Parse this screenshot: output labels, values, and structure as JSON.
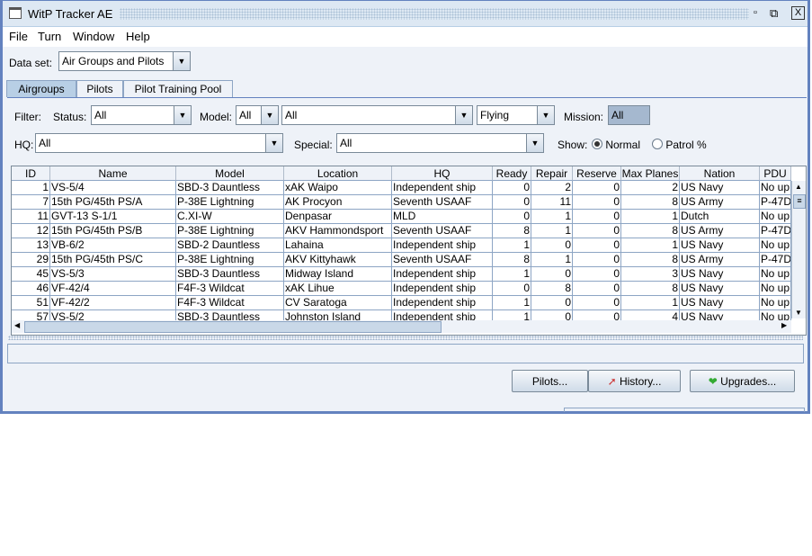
{
  "window": {
    "title": "WitP Tracker AE"
  },
  "menu": [
    "File",
    "Turn",
    "Window",
    "Help"
  ],
  "dataset": {
    "label": "Data set:",
    "value": "Air Groups and Pilots"
  },
  "tabs": [
    {
      "label": "Airgroups",
      "selected": true
    },
    {
      "label": "Pilots"
    },
    {
      "label": "Pilot Training Pool"
    }
  ],
  "filters": {
    "filter_label": "Filter:",
    "status_label": "Status:",
    "status": "All",
    "model_label": "Model:",
    "model_type": "All",
    "model": "All",
    "flying": "Flying",
    "mission_label": "Mission:",
    "mission": "All",
    "hq_label": "HQ:",
    "hq": "All",
    "special_label": "Special:",
    "special": "All",
    "show_label": "Show:",
    "show_normal": "Normal",
    "show_patrol": "Patrol %",
    "show_selected": "Normal"
  },
  "table": {
    "columns": [
      "ID",
      "Name",
      "Model",
      "Location",
      "HQ",
      "Ready",
      "Repair",
      "Reserve",
      "Max Planes",
      "Nation",
      "PDU"
    ],
    "rows": [
      [
        "1",
        "VS-5/4",
        "SBD-3 Dauntless",
        "xAK Waipo",
        "Independent ship",
        "0",
        "2",
        "0",
        "2",
        "US Navy",
        "No up"
      ],
      [
        "7",
        "15th PG/45th PS/A",
        "P-38E Lightning",
        "AK Procyon",
        "Seventh USAAF",
        "0",
        "11",
        "0",
        "8",
        "US Army",
        "P-47D"
      ],
      [
        "11",
        "GVT-13 S-1/1",
        "C.XI-W",
        "Denpasar",
        "MLD",
        "0",
        "1",
        "0",
        "1",
        "Dutch",
        "No up"
      ],
      [
        "12",
        "15th PG/45th PS/B",
        "P-38E Lightning",
        "AKV Hammondsport",
        "Seventh USAAF",
        "8",
        "1",
        "0",
        "8",
        "US Army",
        "P-47D"
      ],
      [
        "13",
        "VB-6/2",
        "SBD-2 Dauntless",
        "Lahaina",
        "Independent ship",
        "1",
        "0",
        "0",
        "1",
        "US Navy",
        "No up"
      ],
      [
        "29",
        "15th PG/45th PS/C",
        "P-38E Lightning",
        "AKV Kittyhawk",
        "Seventh USAAF",
        "8",
        "1",
        "0",
        "8",
        "US Army",
        "P-47D"
      ],
      [
        "45",
        "VS-5/3",
        "SBD-3 Dauntless",
        "Midway Island",
        "Independent ship",
        "1",
        "0",
        "0",
        "3",
        "US Navy",
        "No up"
      ],
      [
        "46",
        "VF-42/4",
        "F4F-3 Wildcat",
        "xAK Lihue",
        "Independent ship",
        "0",
        "8",
        "0",
        "8",
        "US Navy",
        "No up"
      ],
      [
        "51",
        "VF-42/2",
        "F4F-3 Wildcat",
        "CV Saratoga",
        "Independent ship",
        "1",
        "0",
        "0",
        "1",
        "US Navy",
        "No up"
      ],
      [
        "57",
        "VS-5/2",
        "SBD-3 Dauntless",
        "Johnston Island",
        "Independent ship",
        "1",
        "0",
        "0",
        "4",
        "US Navy",
        "No up"
      ]
    ]
  },
  "buttons": {
    "pilots": "Pilots...",
    "history": "History...",
    "upgrades": "Upgrades..."
  }
}
